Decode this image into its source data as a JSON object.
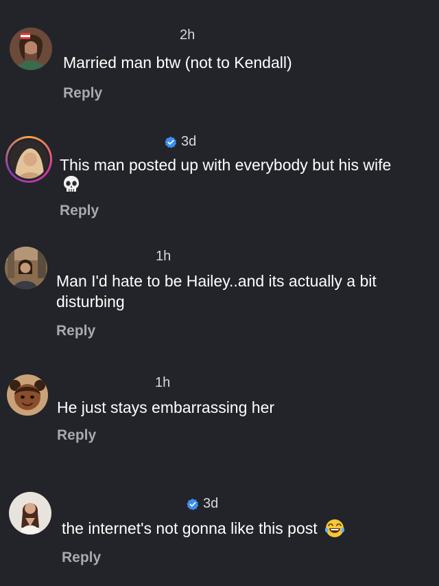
{
  "comments": [
    {
      "time": "2h",
      "verified": false,
      "text": "Married man btw (not to Kendall)",
      "reply_label": "Reply"
    },
    {
      "time": "3d",
      "verified": true,
      "text": "This man posted up with everybody but his wife",
      "emoji": "skull-emoji",
      "reply_label": "Reply"
    },
    {
      "time": "1h",
      "verified": false,
      "text_line1": "Man I'd hate to be Hailey..and its actually a bit",
      "text_line2": "disturbing",
      "reply_label": "Reply"
    },
    {
      "time": "1h",
      "verified": false,
      "text": "He just stays embarrassing her",
      "reply_label": "Reply"
    },
    {
      "time": "3d",
      "verified": true,
      "text": "the internet's not gonna like this post",
      "emoji": "laughing-tears-emoji",
      "reply_label": "Reply"
    }
  ],
  "colors": {
    "background": "#232429",
    "verified_blue": "#3b8ef0",
    "reply_gray": "#a9a9ae",
    "story_ring": "#d8349a"
  }
}
